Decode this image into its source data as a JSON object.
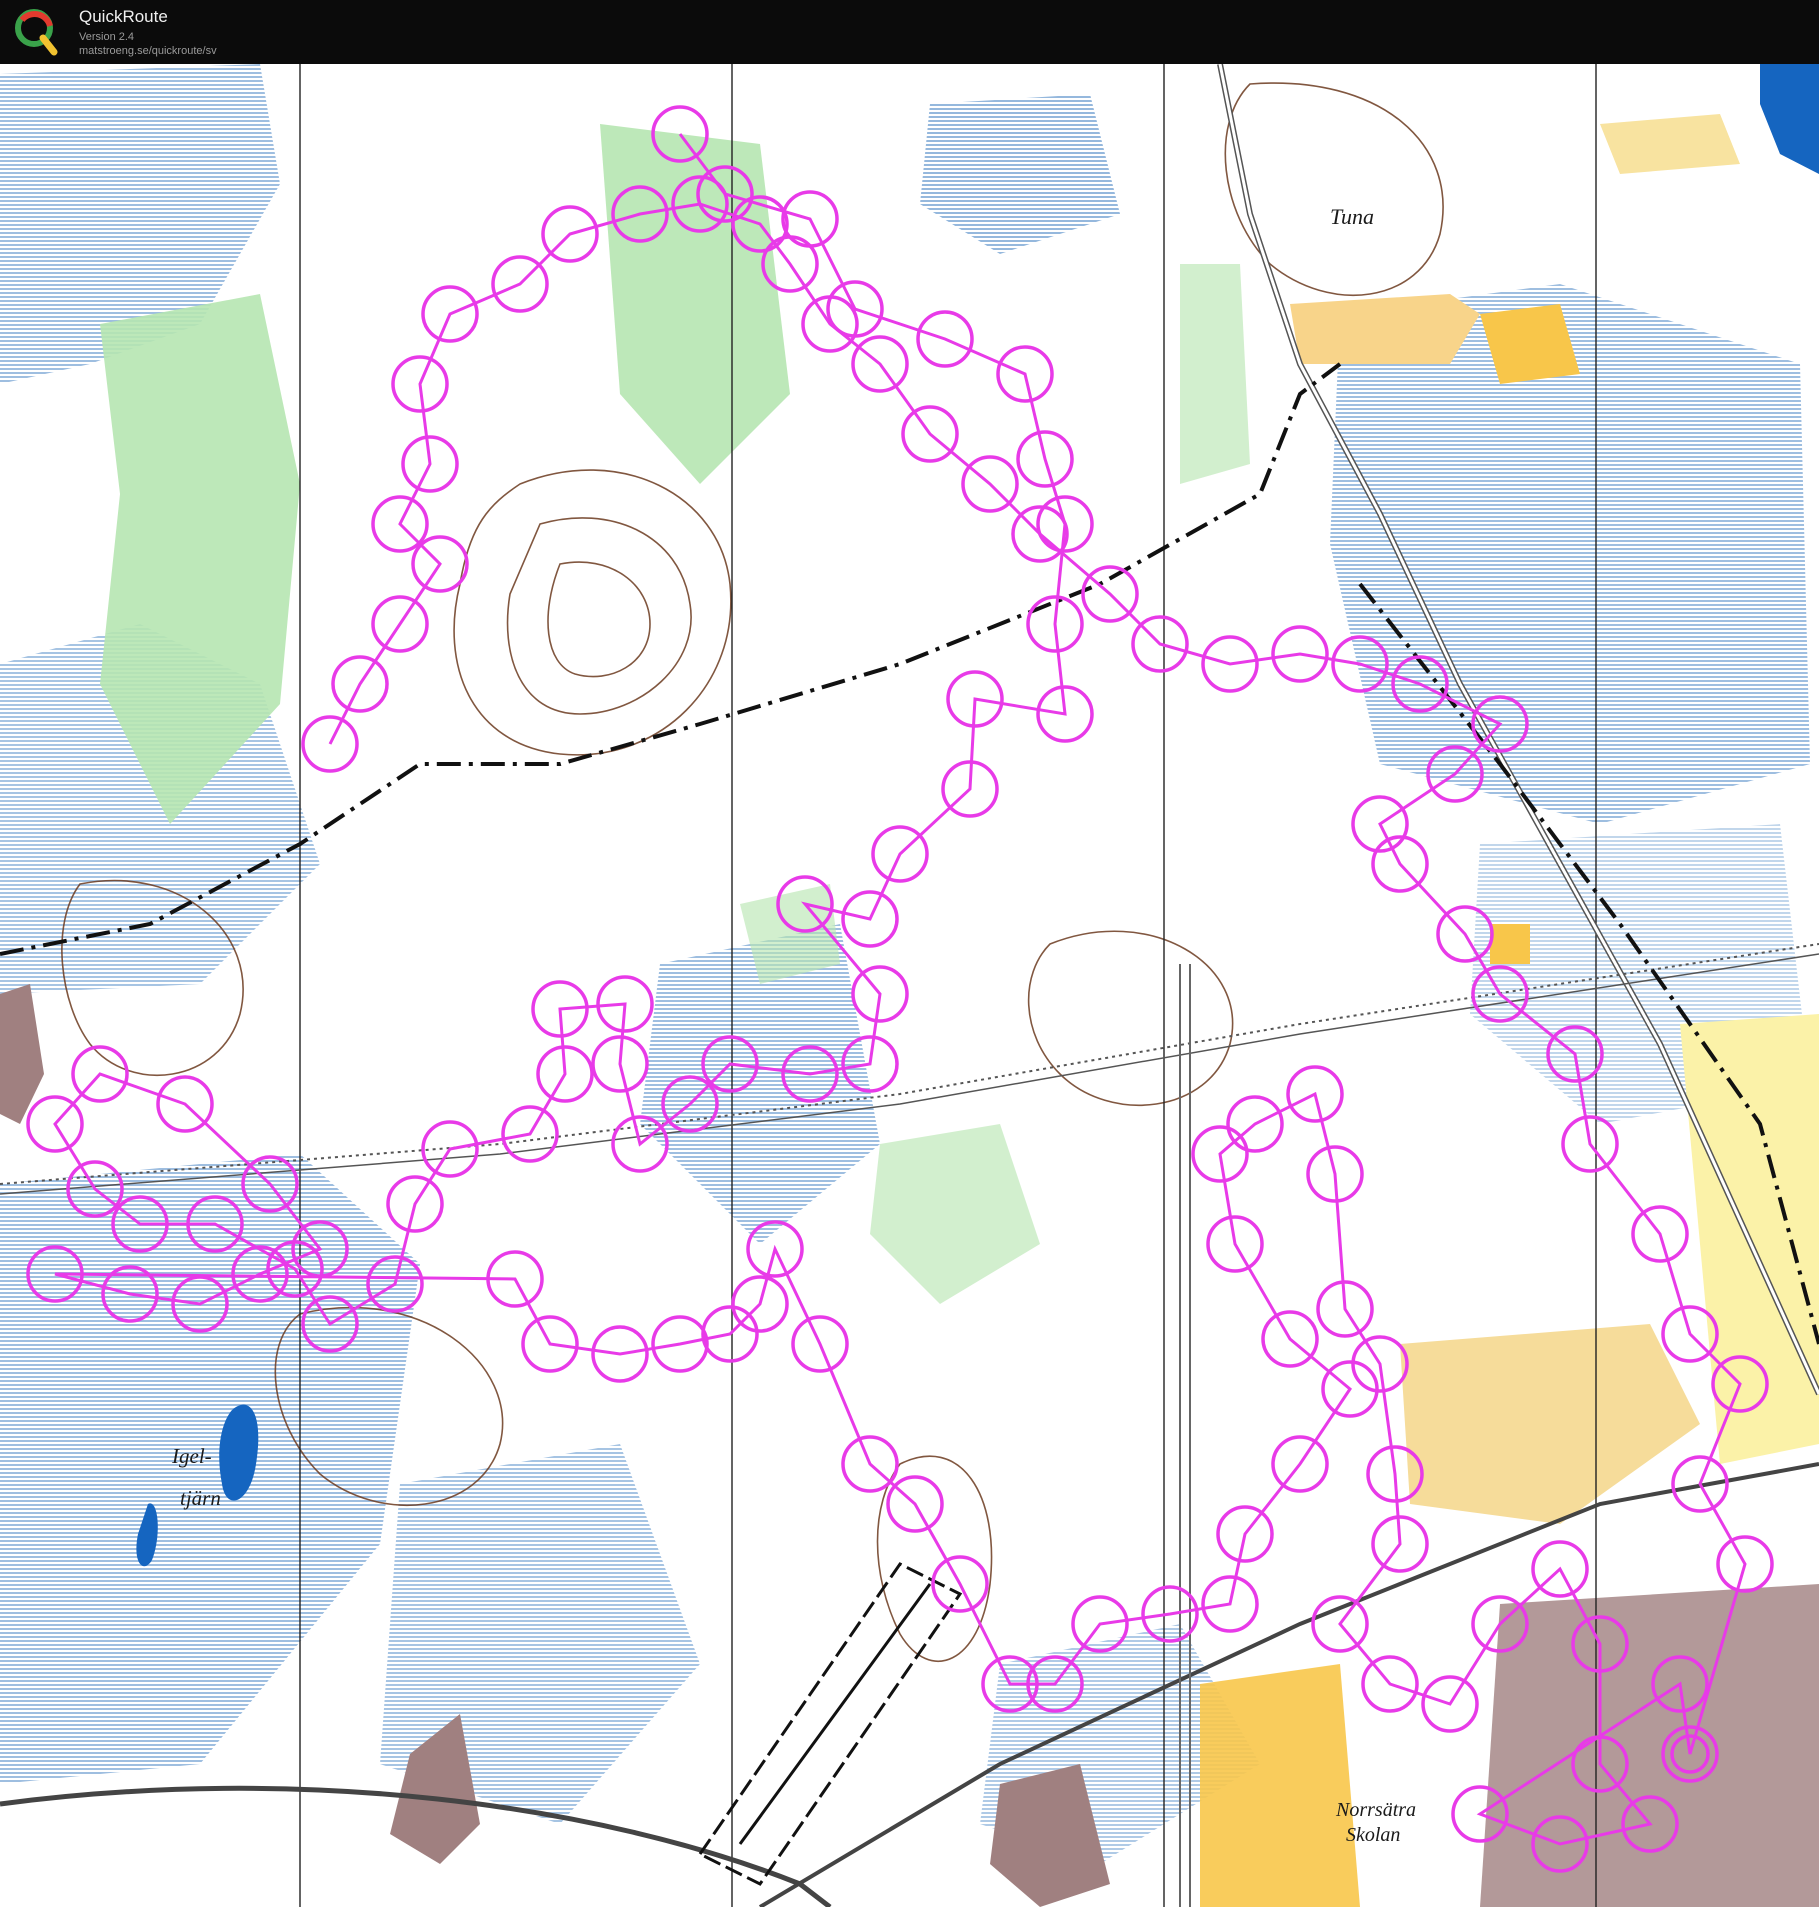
{
  "app": {
    "name": "QuickRoute",
    "version": "Version 2.4",
    "url": "matstroeng.se/quickroute/sv"
  },
  "map": {
    "labels": {
      "tuna": "Tuna",
      "lake_line1": "Igel-",
      "lake_line2": "tjärn",
      "school_line1": "Norrsätra",
      "school_line2": "Skolan"
    }
  },
  "colors": {
    "route": "#e83ae8",
    "marsh": "#2f74bd",
    "open_land": "#f8c64a",
    "vegetation": "#b6e6b1",
    "contour": "#6b3a1f",
    "water": "#1565c0",
    "built_up": "#a08080"
  }
}
